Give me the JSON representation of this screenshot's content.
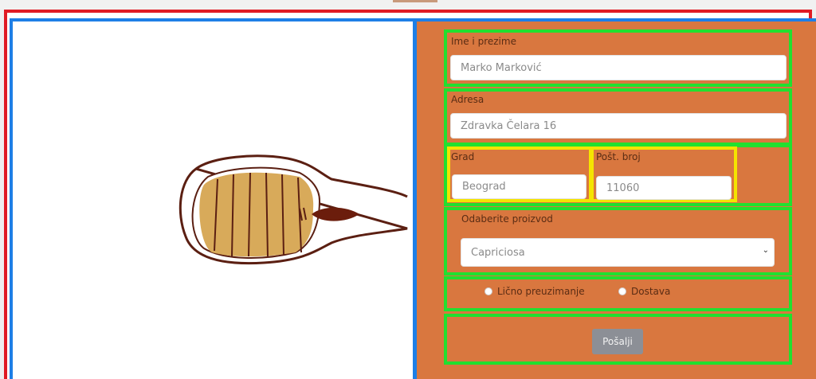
{
  "form": {
    "full_name": {
      "label": "Ime i prezime",
      "value": "Marko Marković"
    },
    "address": {
      "label": "Adresa",
      "value": "Zdravka Čelara 16"
    },
    "city": {
      "label": "Grad",
      "value": "Beograd"
    },
    "postal_code": {
      "label": "Pošt. broj",
      "value": "11060"
    },
    "product": {
      "label": "Odaberite proizvod",
      "selected": "Capriciosa"
    },
    "delivery_options": [
      {
        "label": "Lično preuzimanje",
        "checked": false
      },
      {
        "label": "Dostava",
        "checked": false
      }
    ],
    "submit_label": "Pošalji"
  },
  "colors": {
    "form_background": "#d9773f",
    "outer_frame": "#e01b24",
    "pane_frame": "#1e7fe6",
    "group_frame": "#21e02f",
    "highlight_frame": "#f5e400",
    "button": "#8c8f96"
  },
  "icons": {
    "illustration": "pizza-slice-illustration",
    "select_arrow": "chevron-down-icon"
  }
}
